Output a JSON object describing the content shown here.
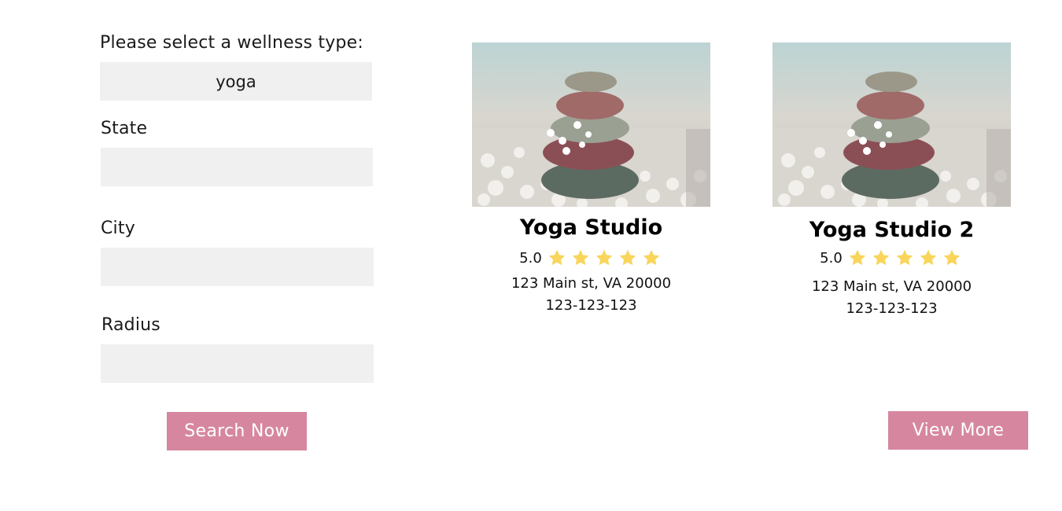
{
  "search_form": {
    "wellness_label": "Please select a wellness type:",
    "wellness_value": "yoga",
    "state_label": "State",
    "state_value": "",
    "city_label": "City",
    "city_value": "",
    "radius_label": "Radius",
    "radius_value": "",
    "search_button": "Search Now"
  },
  "results": [
    {
      "image_icon": "stacked-stones-photo",
      "title": "Yoga Studio",
      "rating": "5.0",
      "stars": 5,
      "address": "123 Main st, VA 20000",
      "phone": "123-123-123"
    },
    {
      "image_icon": "stacked-stones-photo",
      "title": "Yoga Studio 2",
      "rating": "5.0",
      "stars": 5,
      "address": "123 Main st, VA 20000",
      "phone": "123-123-123"
    }
  ],
  "view_more_button": "View More",
  "colors": {
    "accent": "#d6879f",
    "field_bg": "#f0f0f0",
    "star": "#f9d55b"
  }
}
